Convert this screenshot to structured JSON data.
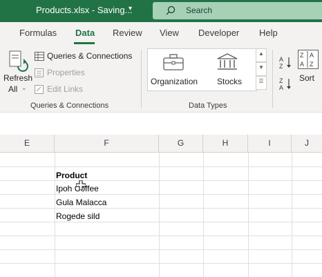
{
  "titlebar": {
    "filename": "Products.xlsx",
    "status": "Saving...",
    "caret": "▾",
    "search_placeholder": "Search"
  },
  "tabs": [
    "Formulas",
    "Data",
    "Review",
    "View",
    "Developer",
    "Help"
  ],
  "active_tab": "Data",
  "queries_group": {
    "refresh_line1": "Refresh",
    "refresh_line2": "All",
    "queries_connections": "Queries & Connections",
    "properties": "Properties",
    "edit_links": "Edit Links",
    "group_label": "Queries & Connections"
  },
  "data_types_group": {
    "organization": "Organization",
    "stocks": "Stocks",
    "group_label": "Data Types"
  },
  "sort_group": {
    "sort": "Sort"
  },
  "columns": [
    "E",
    "F",
    "G",
    "H",
    "I",
    "J"
  ],
  "cells": {
    "header": "Product",
    "rows": [
      "Ipoh Coffee",
      "Gula Malacca",
      "Rogede sild"
    ]
  },
  "colors": {
    "excel_green": "#217346",
    "ribbon_bg": "#f3f2f1"
  }
}
